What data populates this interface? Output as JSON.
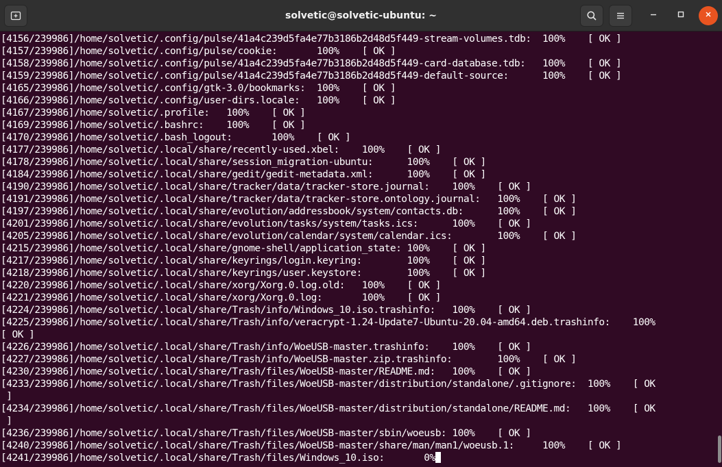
{
  "window": {
    "title": "solvetic@solvetic-ubuntu: ~"
  },
  "titlebar": {
    "new_tab_icon": "new-tab-icon",
    "search_icon": "search-icon",
    "menu_icon": "hamburger-menu-icon",
    "minimize_icon": "minimize-icon",
    "maximize_icon": "maximize-icon",
    "close_icon": "close-icon",
    "close_color": "#e95420"
  },
  "colors": {
    "terminal_bg": "#300a24",
    "titlebar_bg": "#303030",
    "text": "#ffffff"
  },
  "terminal": {
    "lines": [
      "[4156/239986]/home/solvetic/.config/pulse/41a4c239d5fa4e77b3186b2d48d5f449-stream-volumes.tdb:  100%    [ OK ]",
      "[4157/239986]/home/solvetic/.config/pulse/cookie:       100%    [ OK ]",
      "[4158/239986]/home/solvetic/.config/pulse/41a4c239d5fa4e77b3186b2d48d5f449-card-database.tdb:   100%    [ OK ]",
      "[4159/239986]/home/solvetic/.config/pulse/41a4c239d5fa4e77b3186b2d48d5f449-default-source:      100%    [ OK ]",
      "[4165/239986]/home/solvetic/.config/gtk-3.0/bookmarks:  100%    [ OK ]",
      "[4166/239986]/home/solvetic/.config/user-dirs.locale:   100%    [ OK ]",
      "[4167/239986]/home/solvetic/.profile:   100%    [ OK ]",
      "[4169/239986]/home/solvetic/.bashrc:    100%    [ OK ]",
      "[4170/239986]/home/solvetic/.bash_logout:       100%    [ OK ]",
      "[4177/239986]/home/solvetic/.local/share/recently-used.xbel:    100%    [ OK ]",
      "[4178/239986]/home/solvetic/.local/share/session_migration-ubuntu:      100%    [ OK ]",
      "[4184/239986]/home/solvetic/.local/share/gedit/gedit-metadata.xml:      100%    [ OK ]",
      "[4190/239986]/home/solvetic/.local/share/tracker/data/tracker-store.journal:    100%    [ OK ]",
      "[4191/239986]/home/solvetic/.local/share/tracker/data/tracker-store.ontology.journal:   100%    [ OK ]",
      "[4197/239986]/home/solvetic/.local/share/evolution/addressbook/system/contacts.db:      100%    [ OK ]",
      "[4201/239986]/home/solvetic/.local/share/evolution/tasks/system/tasks.ics:      100%    [ OK ]",
      "[4205/239986]/home/solvetic/.local/share/evolution/calendar/system/calendar.ics:        100%    [ OK ]",
      "[4215/239986]/home/solvetic/.local/share/gnome-shell/application_state: 100%    [ OK ]",
      "[4217/239986]/home/solvetic/.local/share/keyrings/login.keyring:        100%    [ OK ]",
      "[4218/239986]/home/solvetic/.local/share/keyrings/user.keystore:        100%    [ OK ]",
      "[4220/239986]/home/solvetic/.local/share/xorg/Xorg.0.log.old:   100%    [ OK ]",
      "[4221/239986]/home/solvetic/.local/share/xorg/Xorg.0.log:       100%    [ OK ]",
      "[4224/239986]/home/solvetic/.local/share/Trash/info/Windows_10.iso.trashinfo:   100%    [ OK ]",
      "[4225/239986]/home/solvetic/.local/share/Trash/info/veracrypt-1.24-Update7-Ubuntu-20.04-amd64.deb.trashinfo:    100%",
      "[ OK ]",
      "[4226/239986]/home/solvetic/.local/share/Trash/info/WoeUSB-master.trashinfo:    100%    [ OK ]",
      "[4227/239986]/home/solvetic/.local/share/Trash/info/WoeUSB-master.zip.trashinfo:        100%    [ OK ]",
      "[4230/239986]/home/solvetic/.local/share/Trash/files/WoeUSB-master/README.md:   100%    [ OK ]",
      "[4233/239986]/home/solvetic/.local/share/Trash/files/WoeUSB-master/distribution/standalone/.gitignore:  100%    [ OK",
      " ]",
      "[4234/239986]/home/solvetic/.local/share/Trash/files/WoeUSB-master/distribution/standalone/README.md:   100%    [ OK",
      " ]",
      "[4236/239986]/home/solvetic/.local/share/Trash/files/WoeUSB-master/sbin/woeusb: 100%    [ OK ]",
      "[4240/239986]/home/solvetic/.local/share/Trash/files/WoeUSB-master/share/man/man1/woeusb.1:     100%    [ OK ]",
      "[4241/239986]/home/solvetic/.local/share/Trash/files/Windows_10.iso:       0%"
    ]
  }
}
